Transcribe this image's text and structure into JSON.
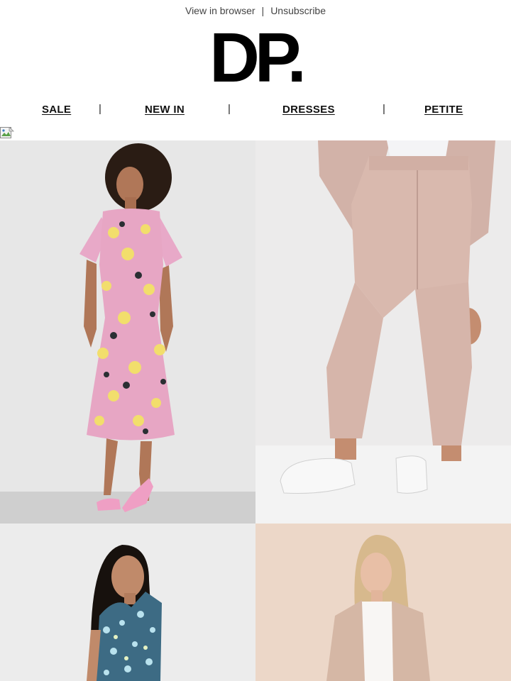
{
  "header": {
    "view_in_browser": "View in browser",
    "separator": "|",
    "unsubscribe": "Unsubscribe",
    "logo_text": "DP."
  },
  "nav": {
    "items": [
      {
        "label": "SALE"
      },
      {
        "label": "NEW IN"
      },
      {
        "label": "DRESSES"
      },
      {
        "label": "PETITE"
      }
    ],
    "separator": "|"
  },
  "products": [
    {
      "icon": "floral-midi-dress-photo",
      "background": "#e6e6e6"
    },
    {
      "icon": "pink-tailored-trousers-photo",
      "background": "#e9e7e8"
    },
    {
      "icon": "blue-floral-dress-photo",
      "background": "#ececec"
    },
    {
      "icon": "blush-blazer-suit-photo",
      "background": "#ecd8c9"
    }
  ]
}
